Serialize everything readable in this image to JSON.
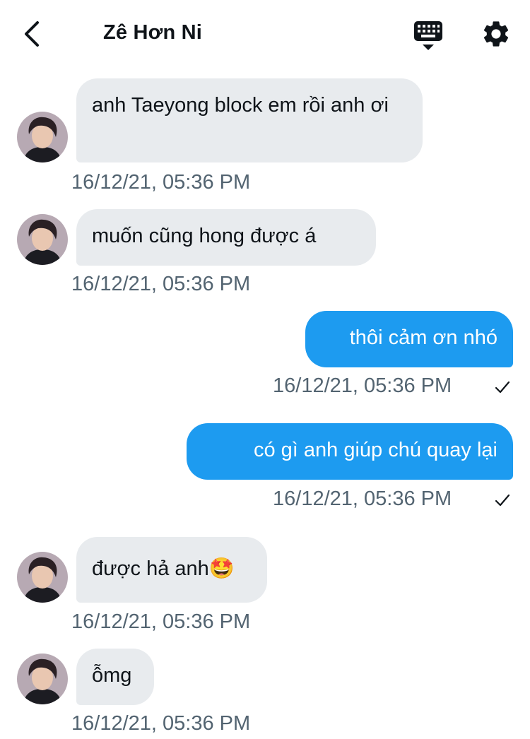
{
  "header": {
    "title": "Zê Hơn Ni",
    "back_icon": "chevron-left-icon",
    "keyboard_icon": "keyboard-icon",
    "settings_icon": "gear-icon"
  },
  "colors": {
    "incoming_bubble": "#e8ebee",
    "outgoing_bubble": "#1d9bf0",
    "timestamp": "#536471"
  },
  "messages": [
    {
      "direction": "in",
      "text": "anh Taeyong block em rồi anh ơi",
      "time": "16/12/21, 05:36 PM"
    },
    {
      "direction": "in",
      "text": "muốn cũng hong được á",
      "time": "16/12/21, 05:36 PM"
    },
    {
      "direction": "out",
      "text": "thôi cảm ơn nhó",
      "time": "16/12/21, 05:36 PM",
      "status_icon": "check-icon"
    },
    {
      "direction": "out",
      "text": "có gì anh giúp chú quay lại",
      "time": "16/12/21, 05:36 PM",
      "status_icon": "check-icon"
    },
    {
      "direction": "in",
      "text": "được hả anh🤩",
      "time": "16/12/21, 05:36 PM"
    },
    {
      "direction": "in",
      "text": "ỗmg",
      "time": "16/12/21, 05:36 PM"
    }
  ]
}
